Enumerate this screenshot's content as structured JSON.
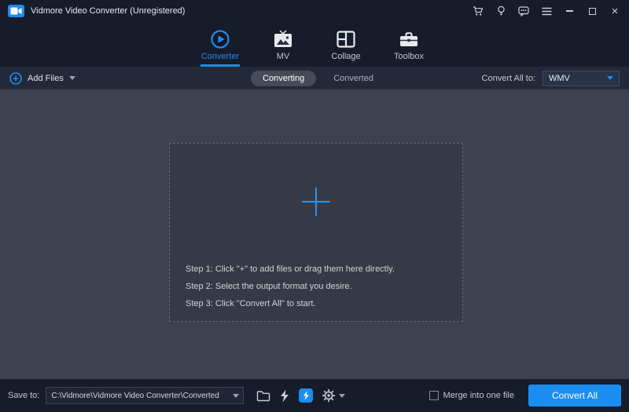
{
  "titlebar": {
    "title": "Vidmore Video Converter (Unregistered)"
  },
  "nav": {
    "tabs": [
      {
        "label": "Converter",
        "active": true
      },
      {
        "label": "MV",
        "active": false
      },
      {
        "label": "Collage",
        "active": false
      },
      {
        "label": "Toolbox",
        "active": false
      }
    ]
  },
  "toolbar": {
    "add_files_label": "Add Files",
    "converting_label": "Converting",
    "converted_label": "Converted",
    "convert_all_to_label": "Convert All to:",
    "selected_format": "WMV"
  },
  "dropzone": {
    "steps": [
      "Step 1: Click \"+\" to add files or drag them here directly.",
      "Step 2: Select the output format you desire.",
      "Step 3: Click \"Convert All\" to start."
    ]
  },
  "footer": {
    "save_to_label": "Save to:",
    "save_path": "C:\\Vidmore\\Vidmore Video Converter\\Converted",
    "merge_label": "Merge into one file",
    "convert_all_label": "Convert All"
  },
  "colors": {
    "accent_blue": "#1b8df2",
    "titlebar_bg": "#171c2a",
    "main_bg": "#3d4250"
  }
}
